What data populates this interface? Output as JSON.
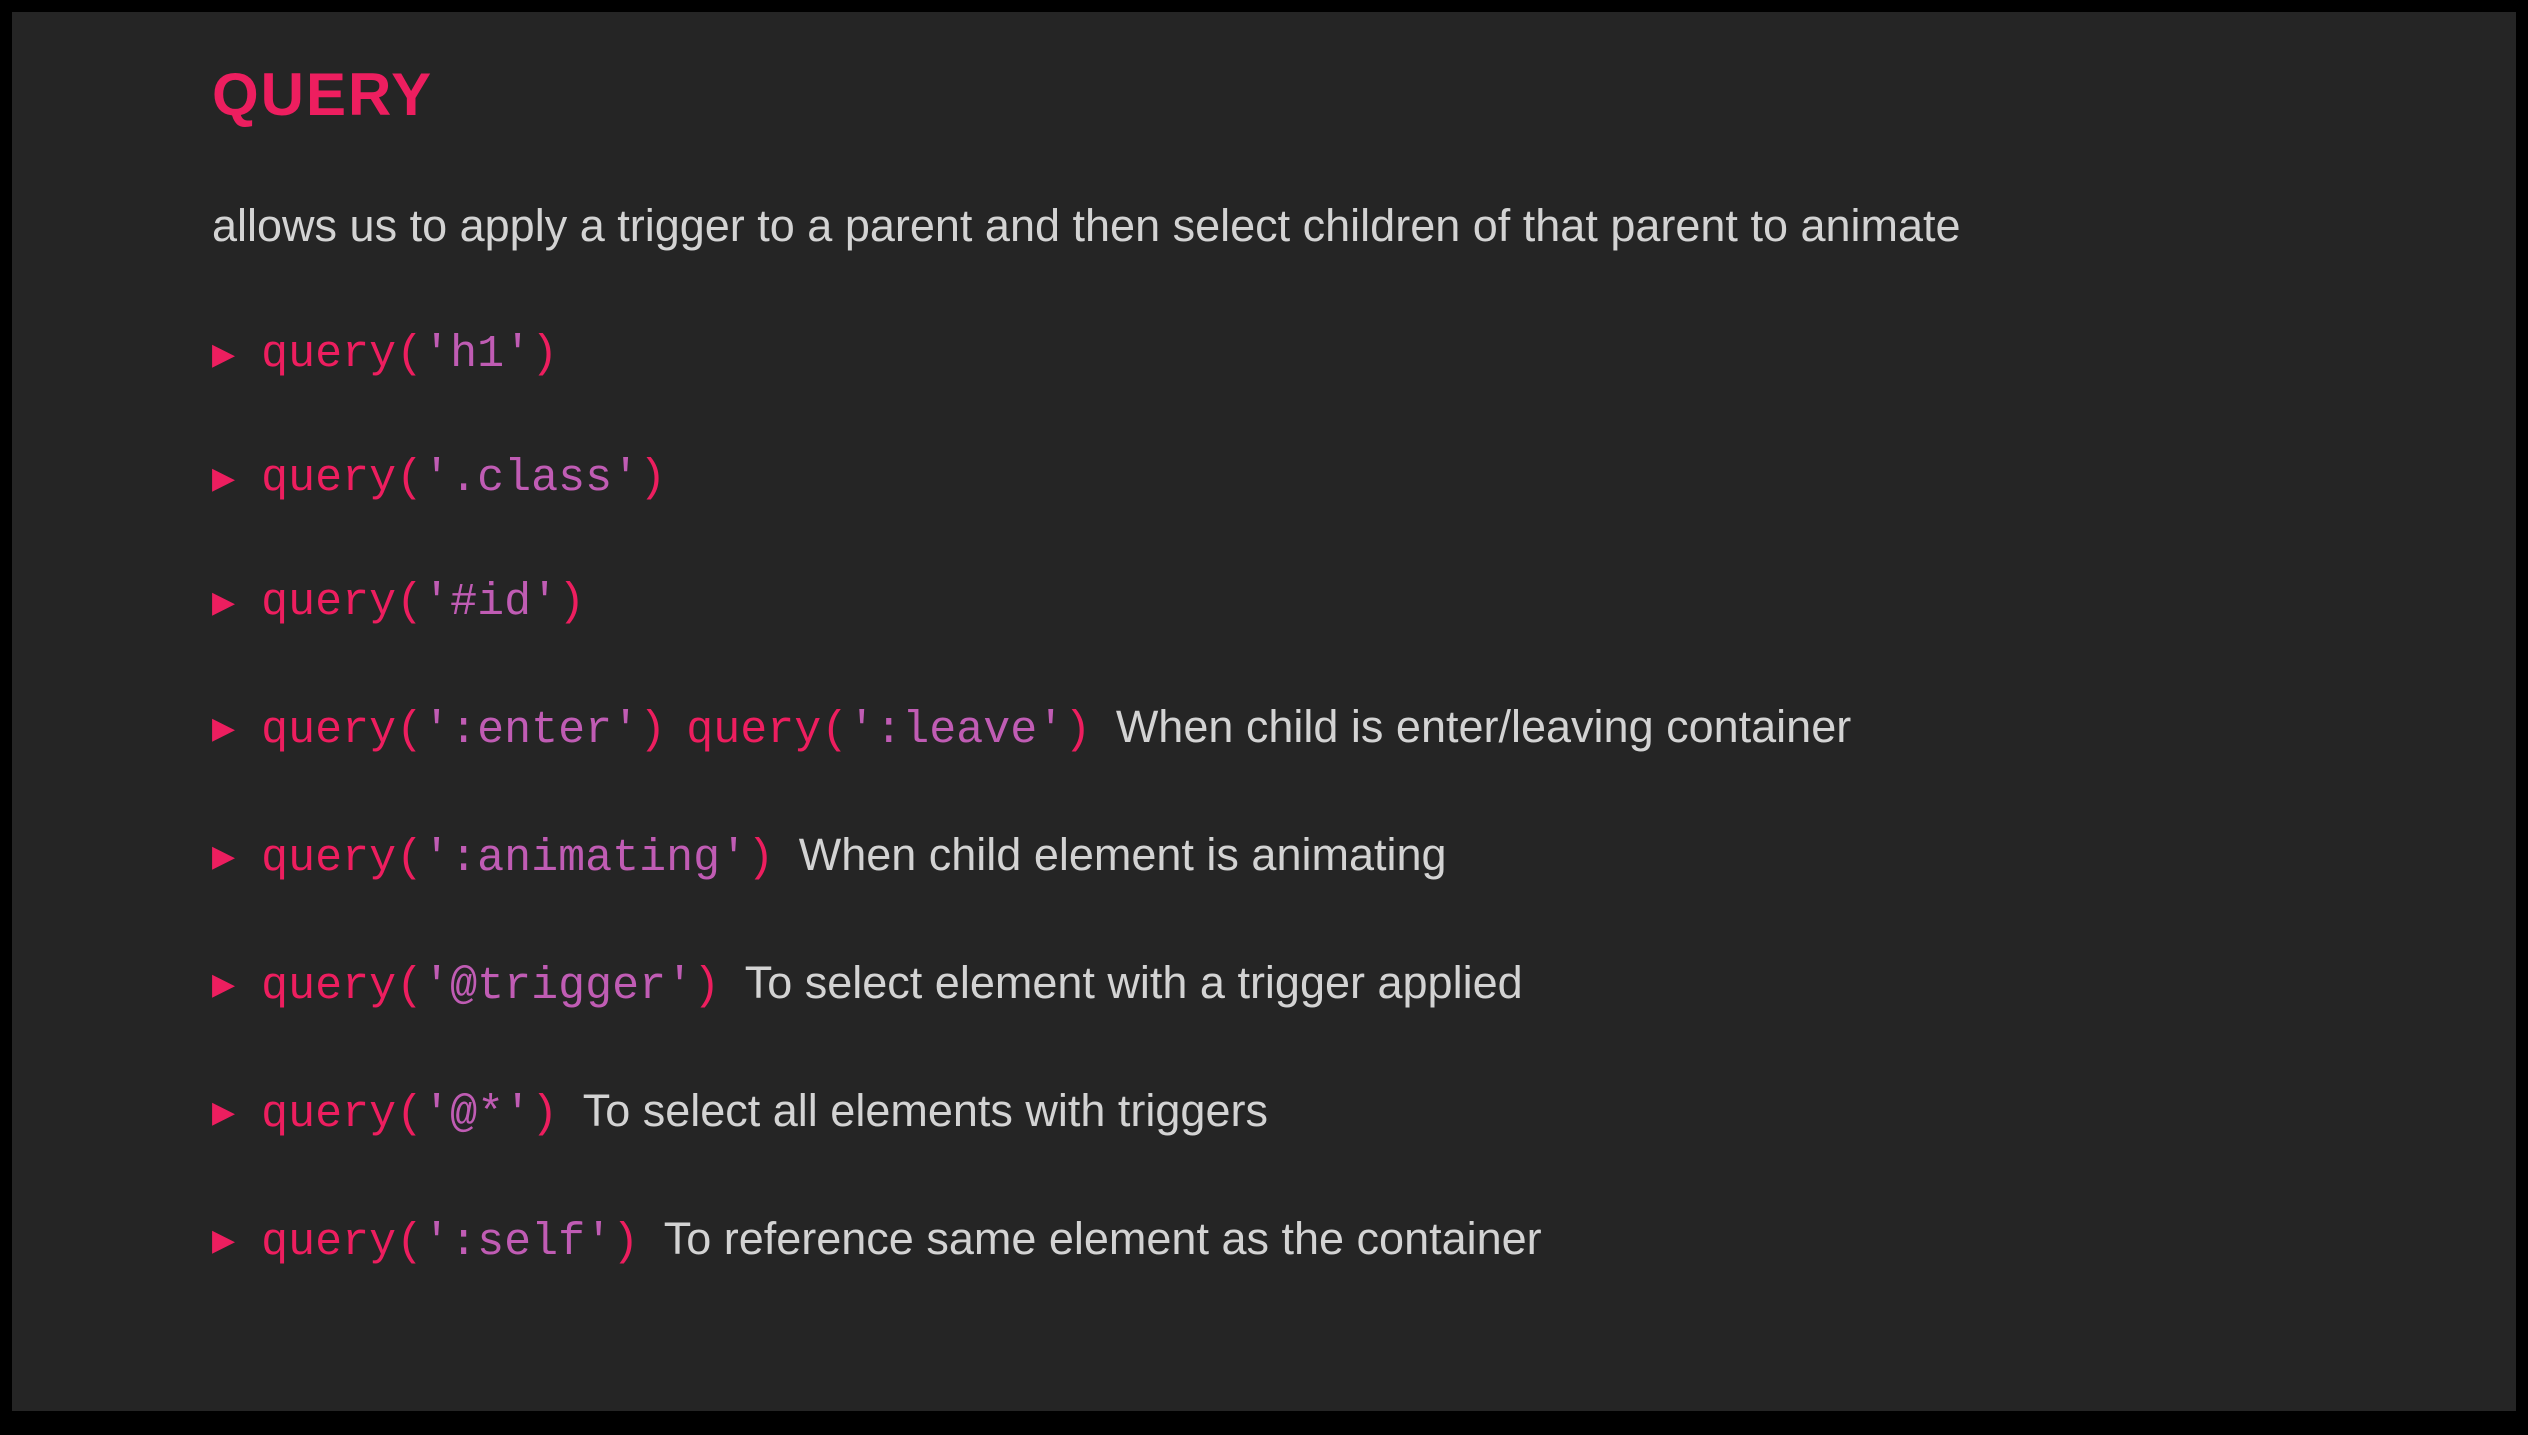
{
  "title": "QUERY",
  "subtitle": "allows us to apply a trigger to a parent and then select children of that parent to animate",
  "items": [
    {
      "fn": "query",
      "paren_open": "(",
      "str": "'h1'",
      "paren_close": ")",
      "desc": ""
    },
    {
      "fn": "query",
      "paren_open": "(",
      "str": "'.class'",
      "paren_close": ")",
      "desc": ""
    },
    {
      "fn": "query",
      "paren_open": "(",
      "str": "'#id'",
      "paren_close": ")",
      "desc": ""
    },
    {
      "fn": "query",
      "paren_open": "(",
      "str": "':enter'",
      "paren_close": ")",
      "fn2": "query",
      "paren_open2": "(",
      "str2": "':leave'",
      "paren_close2": ")",
      "desc": "When child is enter/leaving container"
    },
    {
      "fn": "query",
      "paren_open": "(",
      "str": "':animating'",
      "paren_close": ")",
      "desc": "When child element is animating"
    },
    {
      "fn": "query",
      "paren_open": "(",
      "str": "'@trigger'",
      "paren_close": ")",
      "desc": "To select element with a trigger applied"
    },
    {
      "fn": "query",
      "paren_open": "(",
      "str": "'@*'",
      "paren_close": ")",
      "desc": "To select all elements with triggers"
    },
    {
      "fn": "query",
      "paren_open": "(",
      "str": "':self'",
      "paren_close": ")",
      "desc": "To reference same element as the container"
    }
  ]
}
